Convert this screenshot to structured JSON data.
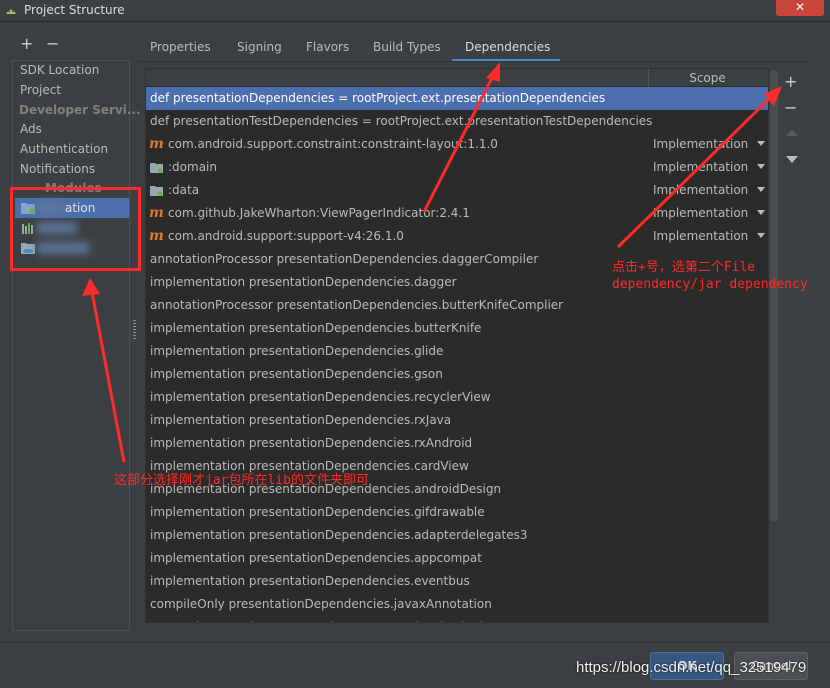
{
  "window": {
    "title": "Project Structure",
    "close_label": "✕"
  },
  "left_toolbar": {
    "add": "+",
    "remove": "−"
  },
  "sidebar": {
    "items": [
      {
        "label": "SDK Location"
      },
      {
        "label": "Project"
      }
    ],
    "developer_services_header": "Developer Servi...",
    "services": [
      {
        "label": "Ads"
      },
      {
        "label": "Authentication"
      },
      {
        "label": "Notifications"
      }
    ],
    "modules_header": "Modules",
    "modules": [
      {
        "label": "ation",
        "selected": true
      },
      {
        "label": ""
      },
      {
        "label": ""
      }
    ]
  },
  "tabs": [
    {
      "label": "Properties"
    },
    {
      "label": "Signing"
    },
    {
      "label": "Flavors"
    },
    {
      "label": "Build Types"
    },
    {
      "label": "Dependencies",
      "active": true
    }
  ],
  "table": {
    "scope_header": "Scope",
    "rows": [
      {
        "text": "def presentationDependencies = rootProject.ext.presentationDependencies",
        "selected": true
      },
      {
        "text": "def presentationTestDependencies = rootProject.ext.presentationTestDependencies"
      },
      {
        "text": "com.android.support.constraint:constraint-layout:1.1.0",
        "icon": "maven-icon",
        "scope": "Implementation"
      },
      {
        "text": ":domain",
        "icon": "module-folder-icon",
        "scope": "Implementation"
      },
      {
        "text": ":data",
        "icon": "module-folder-icon",
        "scope": "Implementation"
      },
      {
        "text": "com.github.JakeWharton:ViewPagerIndicator:2.4.1",
        "icon": "maven-icon",
        "scope": "Implementation"
      },
      {
        "text": "com.android.support:support-v4:26.1.0",
        "icon": "maven-icon",
        "scope": "Implementation"
      },
      {
        "text": "annotationProcessor presentationDependencies.daggerCompiler"
      },
      {
        "text": "implementation presentationDependencies.dagger"
      },
      {
        "text": "annotationProcessor presentationDependencies.butterKnifeComplier"
      },
      {
        "text": "implementation presentationDependencies.butterKnife"
      },
      {
        "text": "implementation presentationDependencies.glide"
      },
      {
        "text": "implementation presentationDependencies.gson"
      },
      {
        "text": "implementation presentationDependencies.recyclerView"
      },
      {
        "text": "implementation presentationDependencies.rxJava"
      },
      {
        "text": "implementation presentationDependencies.rxAndroid"
      },
      {
        "text": "implementation presentationDependencies.cardView"
      },
      {
        "text": "implementation presentationDependencies.androidDesign"
      },
      {
        "text": "implementation presentationDependencies.gifdrawable"
      },
      {
        "text": "implementation presentationDependencies.adapterdelegates3"
      },
      {
        "text": "implementation presentationDependencies.appcompat"
      },
      {
        "text": "implementation presentationDependencies.eventbus"
      },
      {
        "text": "compileOnly presentationDependencies.javaxAnnotation"
      },
      {
        "text": "testImplementation presentationTestDependencies.junit"
      }
    ]
  },
  "right_tools": {
    "add": "+",
    "remove": "−"
  },
  "buttons": {
    "ok": "OK",
    "cancel": "Cancel"
  },
  "annotations": {
    "right_line1": "点击+号，选第二个File",
    "right_line2": "dependency/jar dependency",
    "left": "这部分选择刚才jar包所在lib的文件夹即可"
  },
  "watermark": "https://blog.csdn.net/qq_32519479",
  "colors": {
    "background": "#3c3f41",
    "table_bg": "#2b2b2b",
    "selection": "#4b6eaf",
    "annotation_red": "#ff2a2a",
    "maven_orange": "#e0782d",
    "tab_accent": "#4a88c7"
  }
}
